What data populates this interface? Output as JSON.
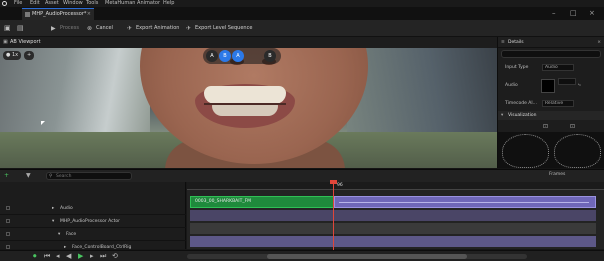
{
  "menu": [
    "File",
    "Edit",
    "Asset",
    "Window",
    "Tools",
    "MetaHuman Animator",
    "Help"
  ],
  "tab": {
    "title": "MHP_AudioProcessor*",
    "close": "×"
  },
  "window_controls": [
    "–",
    "□",
    "×"
  ],
  "toolbar": {
    "process": "Process",
    "cancel": "Cancel",
    "export_animation": "Export Animation",
    "export_level_sequence": "Export Level Sequence"
  },
  "viewport": {
    "tab_label": "AB Viewport",
    "chip_left": "1x",
    "face_mode_buttons": [
      "A",
      "B",
      "A",
      "B"
    ]
  },
  "details": {
    "title": "Details",
    "rows": [
      {
        "label": "Input Type",
        "value": "Audio"
      },
      {
        "label": "Audio",
        "value": ""
      },
      {
        "label": "Timecode Al...",
        "value": "Relative"
      }
    ],
    "section": "Visualization"
  },
  "sequencer": {
    "search_placeholder": "Search",
    "frames_label": "Frames",
    "ruler_marker": "96",
    "tracks": [
      {
        "name": "Audio",
        "indent": 1
      },
      {
        "name": "MHP_AudioProcessor Actor",
        "indent": 1
      },
      {
        "name": "Face",
        "indent": 2
      },
      {
        "name": "Face_ControlBoard_CtrlRig",
        "indent": 3
      }
    ],
    "audio_clip_label": "0003_00_SHARKBAIT_FM"
  },
  "colors": {
    "accent_blue": "#2c79e8",
    "audio_green": "#1f8a3c",
    "track_purple": "#6f67b8",
    "playhead_red": "#e0463a",
    "play_green": "#49c460"
  }
}
